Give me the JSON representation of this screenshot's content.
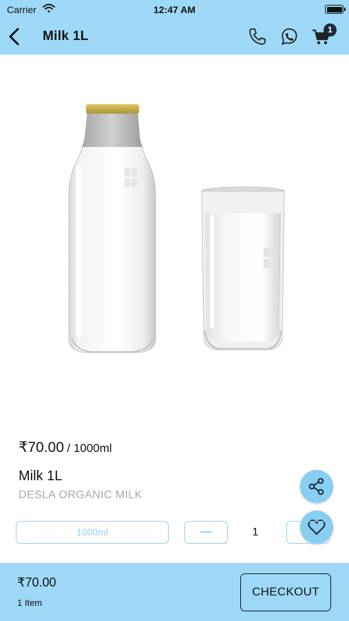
{
  "status_bar": {
    "carrier": "Carrier",
    "time": "12:47 AM",
    "wifi_icon": "wifi-icon",
    "battery_icon": "battery-icon"
  },
  "nav": {
    "back_icon": "chevron-left-icon",
    "title": "Milk 1L",
    "phone_icon": "phone-icon",
    "whatsapp_icon": "whatsapp-icon",
    "cart_icon": "cart-icon",
    "cart_count": "1"
  },
  "product": {
    "price": "₹70.00",
    "unit": "/ 1000ml",
    "name": "Milk 1L",
    "brand": "DESLA ORGANIC MILK",
    "image": "milk-bottle-and-glass-image"
  },
  "actions": {
    "share_icon": "share-icon",
    "favorite_icon": "heart-icon"
  },
  "variant": {
    "selected": "1000ml"
  },
  "quantity": {
    "value": "1",
    "minus_icon": "minus-icon",
    "plus_icon": "plus-icon"
  },
  "footer": {
    "total": "₹70.00",
    "items": "1 Item",
    "checkout_label": "CHECKOUT"
  },
  "colors": {
    "header_bg": "#9dd9f6",
    "accent": "#8fd3f2",
    "fab": "#87cef0",
    "badge": "#1c2a3a",
    "brand_text": "#a8a8a8"
  }
}
